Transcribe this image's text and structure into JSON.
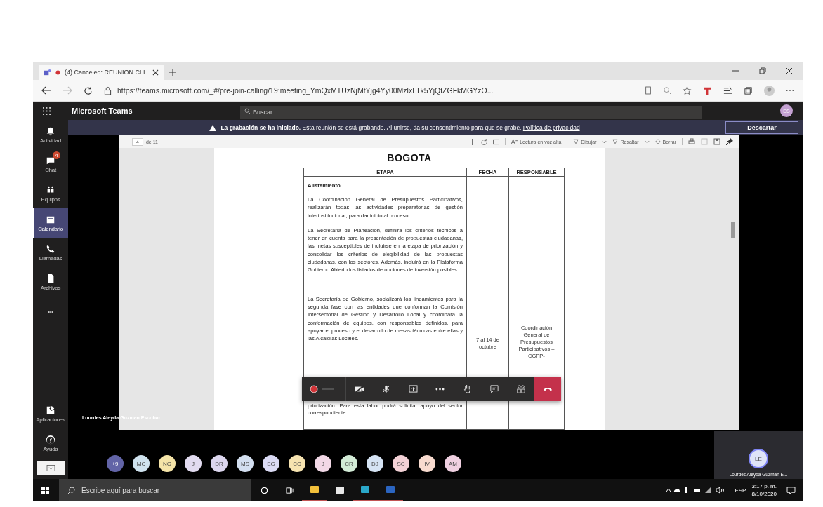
{
  "browser": {
    "tab": {
      "title": "(4) Canceled: REUNION CLI"
    },
    "url": "https://teams.microsoft.com/_#/pre-join-calling/19:meeting_YmQxMTUzNjMtYjg4Yy00MzlxLTk5YjQtZGFkMGYzO..."
  },
  "teams": {
    "app_name": "Microsoft Teams",
    "search": {
      "placeholder": "Buscar"
    },
    "user_avatar": {
      "initials": "ES"
    }
  },
  "banner": {
    "title": "La grabación se ha iniciado.",
    "text": "Esta reunión se está grabando. Al unirse, da su consentimiento para que se grabe.",
    "link": "Política de privacidad",
    "button": "Descartar"
  },
  "sidebar": {
    "items": [
      {
        "kind": "activity",
        "label": "Actividad",
        "selected": false
      },
      {
        "kind": "chat",
        "label": "Chat",
        "badge": "4",
        "selected": false
      },
      {
        "kind": "teams",
        "label": "Equipos",
        "selected": false
      },
      {
        "kind": "calendar",
        "label": "Calendario",
        "selected": true
      },
      {
        "kind": "calls",
        "label": "Llamadas",
        "selected": false
      },
      {
        "kind": "files",
        "label": "Archivos",
        "selected": false
      },
      {
        "kind": "more",
        "label": "•••",
        "selected": false
      }
    ],
    "bottom_items": [
      {
        "kind": "apps",
        "label": "Aplicaciones"
      },
      {
        "kind": "help",
        "label": "Ayuda"
      }
    ]
  },
  "pdf_toolbar": {
    "page": "4",
    "page_count": "de 11",
    "read_aloud": "Lectura en voz alta",
    "draw": "Dibujar",
    "highlight": "Resaltar",
    "erase": "Borrar"
  },
  "document": {
    "logo": "BOGOTA",
    "table": {
      "columns": [
        "ETAPA",
        "FECHA",
        "RESPONSABLE"
      ],
      "row": {
        "heading": "Alistamiento",
        "paragraphs": [
          "La Coordinación General de Presupuestos Participativos, realizarán todas las actividades preparatorias de gestión interinstitucional, para dar inicio al proceso.",
          "La Secretaría de Planeación, definirá los criterios técnicos a tener en cuenta para la presentación de propuestas ciudadanas, las metas susceptibles de incluirse en la etapa de priorización y consolidar los criterios de elegibilidad de las propuestas ciudadanas, con los sectores. Además, incluirá en la Plataforma Gobierno Abierto los listados de opciones de inversión posibles.",
          "La Secretaría de Gobierno, socializará los lineamientos para la segunda fase con las entidades que conforman la Comisión Intersectorial de Gestión y Desarrollo Local y coordinará la conformación de equipos, con responsables definidos, para apoyar el proceso y el desarrollo de mesas técnicas entre ellas y las Alcaldías Locales."
        ],
        "tail": "priorización. Para esta labor podrá solicitar apoyo del sector correspondiente.",
        "fecha": "7 al 14 de octubre",
        "responsable": "Coordinación General de Presupuestos Participativos – CGPP-"
      }
    }
  },
  "presenter_name": "Lourdes Aleyda Guzman Escobar",
  "call_controls": [
    {
      "kind": "record"
    },
    {
      "kind": "camera-off"
    },
    {
      "kind": "mic-off"
    },
    {
      "kind": "share"
    },
    {
      "kind": "more"
    },
    {
      "kind": "raise-hand"
    },
    {
      "kind": "chat"
    },
    {
      "kind": "participants"
    },
    {
      "kind": "hang-up"
    }
  ],
  "participants": {
    "overflow": "+9",
    "people": [
      {
        "initials": "MC",
        "color": "#cfe2ee"
      },
      {
        "initials": "NG",
        "color": "#f5e4a8"
      },
      {
        "initials": "J",
        "color": "#e2dbf0"
      },
      {
        "initials": "DR",
        "color": "#dcd6ee"
      },
      {
        "initials": "MS",
        "color": "#d3dff0"
      },
      {
        "initials": "EG",
        "color": "#dadaf4"
      },
      {
        "initials": "CC",
        "color": "#f6e3b0"
      },
      {
        "initials": "J",
        "color": "#f2d8e6"
      },
      {
        "initials": "CR",
        "color": "#d3ecd7"
      },
      {
        "initials": "DJ",
        "color": "#d5e3f4"
      },
      {
        "initials": "SC",
        "color": "#f3d1d6"
      },
      {
        "initials": "IV",
        "color": "#f8dbcf"
      },
      {
        "initials": "AM",
        "color": "#f0d0e1"
      }
    ],
    "self": {
      "initials": "LE",
      "name": "Lourdes Aleyda Guzman E..."
    }
  },
  "taskbar": {
    "search_placeholder": "Escribe aquí para buscar",
    "apps": [
      {
        "kind": "cortana",
        "running": false
      },
      {
        "kind": "task-view",
        "running": false
      },
      {
        "kind": "explorer",
        "running": true
      },
      {
        "kind": "store",
        "running": false
      },
      {
        "kind": "edge",
        "running": true
      },
      {
        "kind": "word",
        "running": true
      }
    ],
    "language": "ESP",
    "time": "3:17 p. m.",
    "date": "8/10/2020"
  }
}
